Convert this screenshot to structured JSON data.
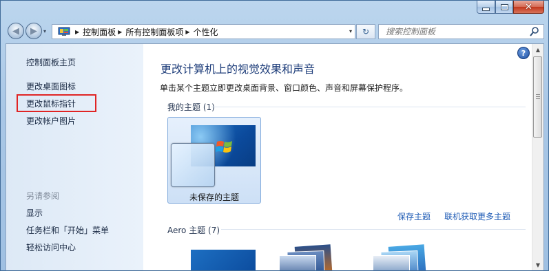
{
  "window": {
    "minimize_glyph": "─",
    "maximize_glyph": "□",
    "close_glyph": "✕"
  },
  "nav": {
    "back_glyph": "◀",
    "forward_glyph": "▶",
    "recent_glyph": "▾",
    "breadcrumb": [
      "控制面板",
      "所有控制面板项",
      "个性化"
    ],
    "crumb_sep": "▶",
    "refresh_glyph": "↻",
    "search_placeholder": "搜索控制面板"
  },
  "sidebar": {
    "home": "控制面板主页",
    "links": [
      "更改桌面图标",
      "更改鼠标指针",
      "更改帐户图片"
    ],
    "see_also_label": "另请参阅",
    "see_also": [
      "显示",
      "任务栏和「开始」菜单",
      "轻松访问中心"
    ],
    "highlight_color": "#e02424"
  },
  "main": {
    "help_glyph": "?",
    "title": "更改计算机上的视觉效果和声音",
    "description": "单击某个主题立即更改桌面背景、窗口颜色、声音和屏幕保护程序。",
    "my_themes_label": "我的主题 (1)",
    "unsaved_theme_label": "未保存的主题",
    "save_theme_link": "保存主题",
    "online_themes_link": "联机获取更多主题",
    "aero_label": "Aero 主题 (7)"
  },
  "scrollbar": {
    "up_glyph": "▲",
    "down_glyph": "▼"
  },
  "colors": {
    "title": "#1e3d7a",
    "link": "#1e5bb5",
    "sidebar_bg": "#e3edf8",
    "window_frame": "#a9c7e6"
  }
}
